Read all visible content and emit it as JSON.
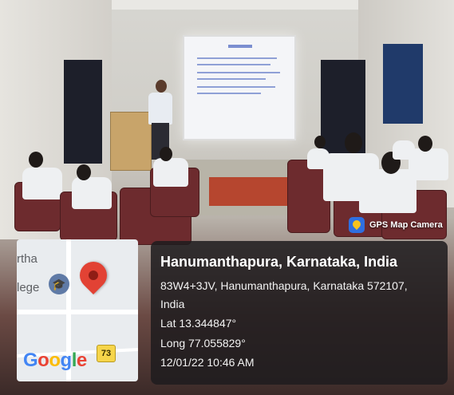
{
  "gps_overlay": {
    "app_label": "GPS Map Camera",
    "app_icon": "gps-map-camera-icon",
    "place_title": "Hanumanthapura, Karnataka, India",
    "address_line1": "83W4+3JV, Hanumanthapura, Karnataka 572107,",
    "address_line2": "India",
    "latitude": "Lat 13.344847°",
    "longitude": "Long 77.055829°",
    "timestamp": "12/01/22 10:46 AM"
  },
  "map_thumbnail": {
    "place_text_1": "rtha",
    "place_text_2": "lege",
    "google_logo": [
      "G",
      "o",
      "o",
      "g",
      "l",
      "e"
    ],
    "road_shield": "73",
    "pin_color": "#e24234"
  }
}
